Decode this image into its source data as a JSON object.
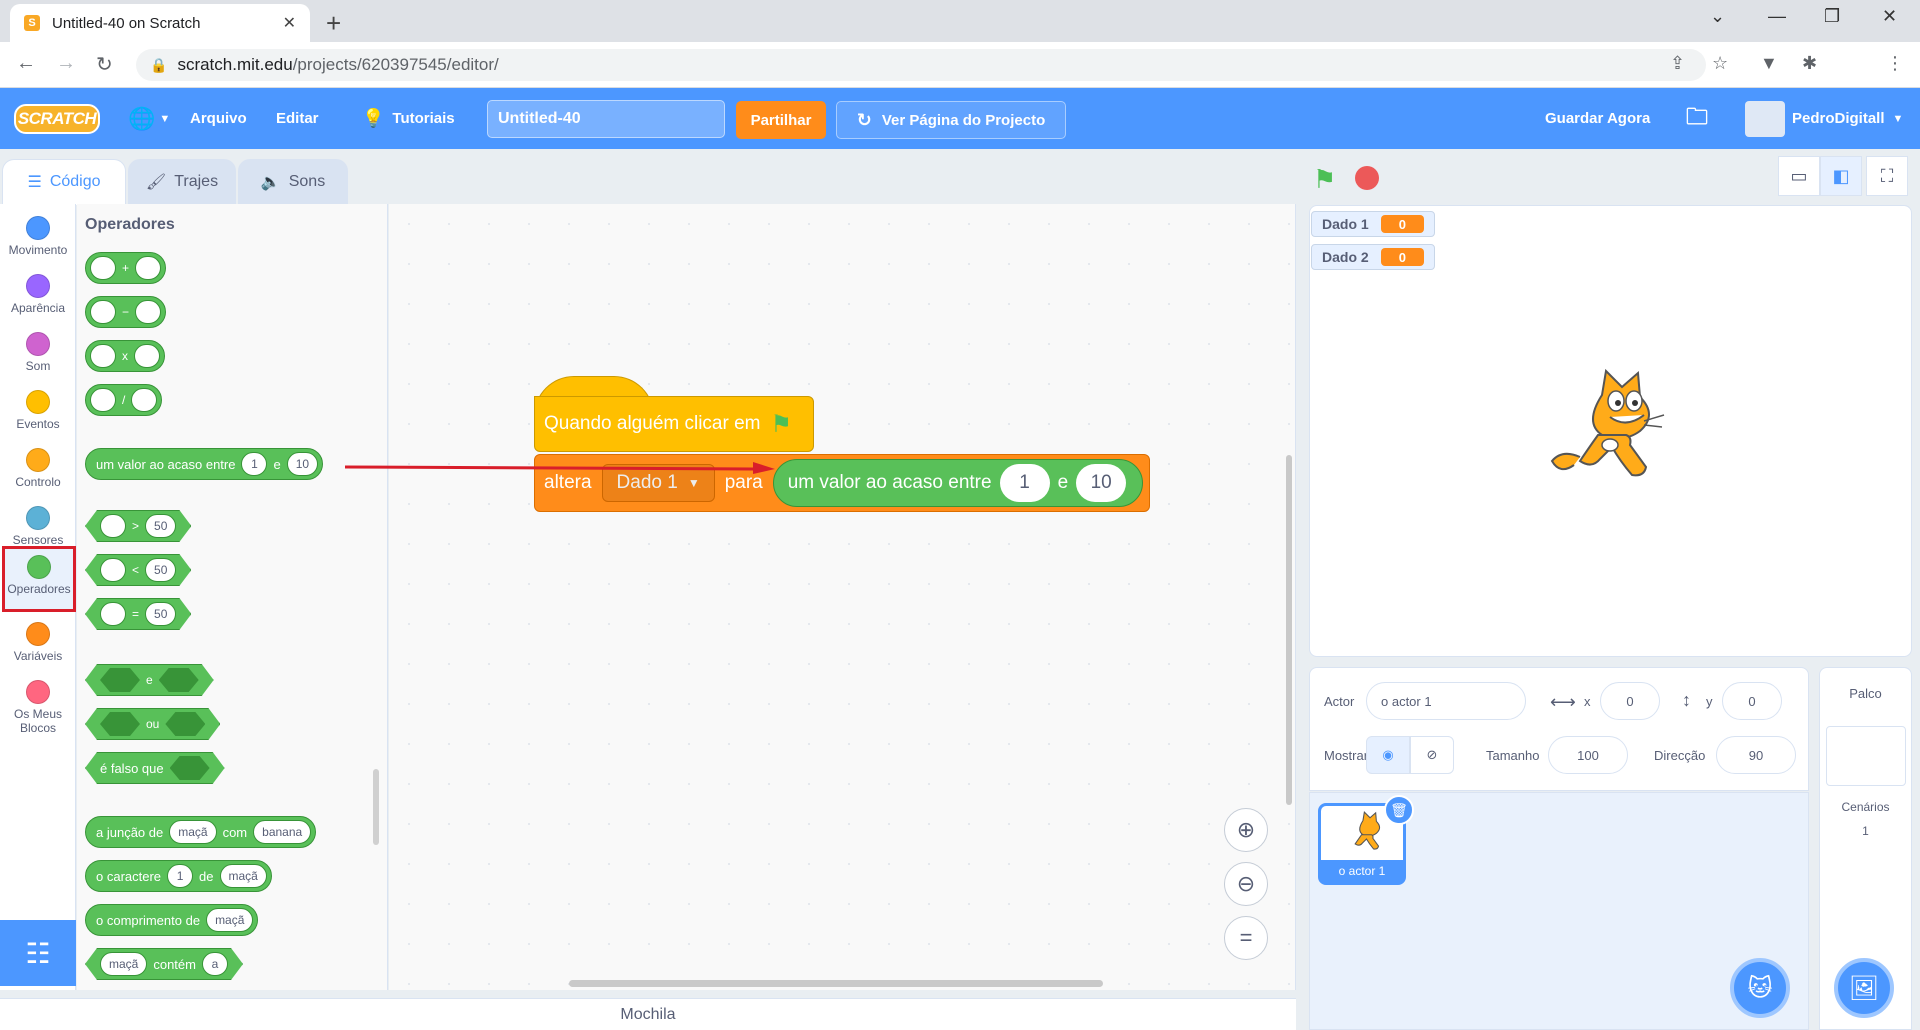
{
  "browser": {
    "tab_title": "Untitled-40 on Scratch",
    "tab_close": "✕",
    "new_tab": "+",
    "url_host": "scratch.mit.edu",
    "url_path": "/projects/620397545/editor/"
  },
  "menubar": {
    "logo": "SCRATCH",
    "file": "Arquivo",
    "edit": "Editar",
    "tutorials": "Tutoriais",
    "project_title": "Untitled-40",
    "share": "Partilhar",
    "project_page": "Ver Página do Projecto",
    "save_now": "Guardar Agora",
    "username": "PedroDigitall"
  },
  "editor_tabs": {
    "code": "Código",
    "costumes": "Trajes",
    "sounds": "Sons"
  },
  "categories": [
    {
      "label": "Movimento",
      "color": "#4c97ff"
    },
    {
      "label": "Aparência",
      "color": "#9966ff"
    },
    {
      "label": "Som",
      "color": "#cf63cf"
    },
    {
      "label": "Eventos",
      "color": "#ffbf00"
    },
    {
      "label": "Controlo",
      "color": "#ffab19"
    },
    {
      "label": "Sensores",
      "color": "#5cb1d6"
    },
    {
      "label": "Operadores",
      "color": "#59c059"
    },
    {
      "label": "Variáveis",
      "color": "#ff8c1a"
    },
    {
      "label": "Os Meus Blocos",
      "color": "#ff6680"
    }
  ],
  "palette": {
    "title": "Operadores",
    "plus": "+",
    "minus": "−",
    "times": "x",
    "divide": "/",
    "random": {
      "text1": "um valor ao acaso entre",
      "from": "1",
      "and": "e",
      "to": "10"
    },
    "gt": {
      "op": ">",
      "value": "50"
    },
    "lt": {
      "op": "<",
      "value": "50"
    },
    "eq": {
      "op": "=",
      "value": "50"
    },
    "and": "e",
    "or": "ou",
    "not": "é falso que",
    "join": {
      "text1": "a junção de",
      "a": "maçã",
      "with": "com",
      "b": "banana"
    },
    "letter": {
      "text1": "o caractere",
      "n": "1",
      "of": "de",
      "word": "maçã"
    },
    "length": {
      "text1": "o comprimento de",
      "word": "maçã"
    },
    "contains": {
      "word": "maçã",
      "text1": "contém",
      "letter": "a"
    }
  },
  "script": {
    "hat_text": "Quando alguém clicar em",
    "set_text": "altera",
    "variable": "Dado 1",
    "to_text": "para",
    "random_text": "um valor ao acaso entre",
    "from": "1",
    "and": "e",
    "to": "10"
  },
  "backpack": "Mochila",
  "monitors": [
    {
      "name": "Dado 1",
      "value": "0"
    },
    {
      "name": "Dado 2",
      "value": "0"
    }
  ],
  "sprite_info": {
    "sprite_label": "Actor",
    "sprite_name": "o actor 1",
    "x_label": "x",
    "x_value": "0",
    "y_label": "y",
    "y_value": "0",
    "show_label": "Mostrar",
    "size_label": "Tamanho",
    "size_value": "100",
    "direction_label": "Direcção",
    "direction_value": "90"
  },
  "sprite_tile_name": "o actor 1",
  "stage_pane": {
    "label": "Palco",
    "backdrops_label": "Cenários",
    "backdrops_count": "1"
  },
  "colors": {
    "menu": "#4c97ff",
    "operators": "#59c059",
    "events": "#ffbf00",
    "variables": "#ff8c1a",
    "highlight": "#d91e2a"
  }
}
